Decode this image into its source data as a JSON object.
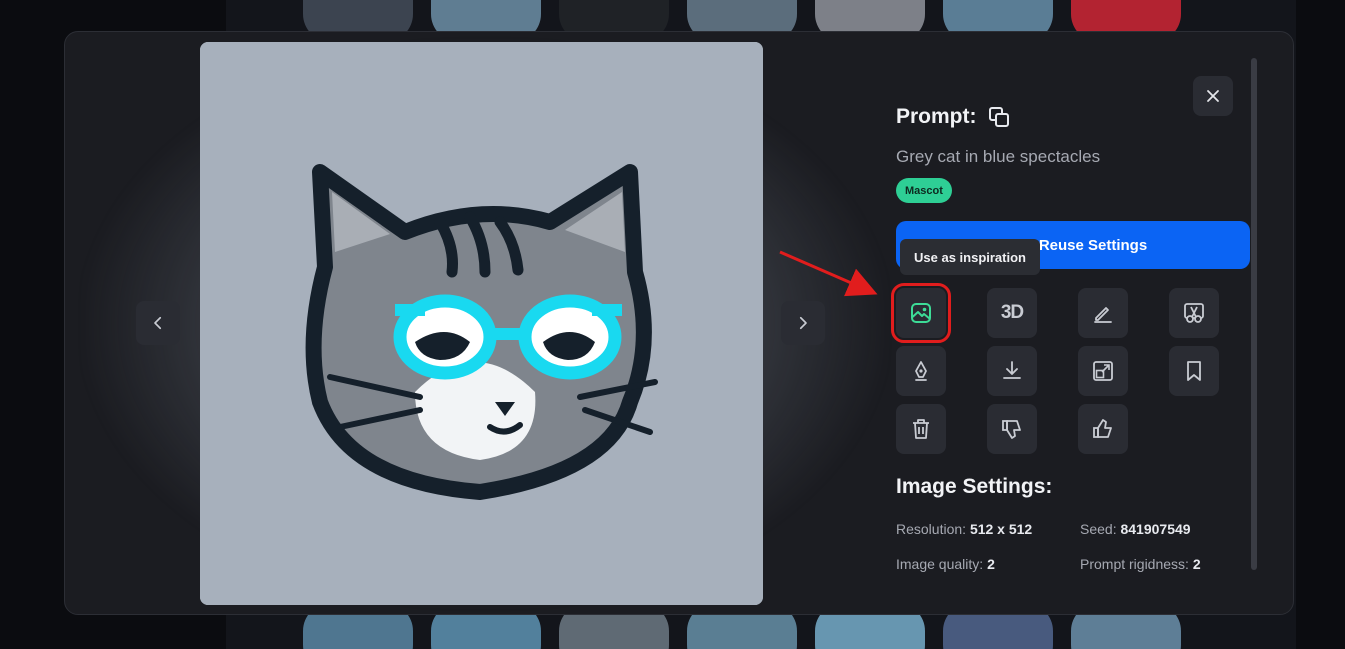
{
  "background_thumbs": {
    "top": [
      "#3c4450",
      "#5f7d92",
      "#1f2226",
      "#5b6d7c",
      "#7d8088",
      "#5a7d95",
      "#b32331"
    ],
    "bottom": [
      "#4f7690",
      "#52809c",
      "#5f6a74",
      "#5a7e93",
      "#6796b0",
      "#485a7e",
      "#5e7e96"
    ]
  },
  "modal": {
    "image": {
      "alt_subject": "cat-mascot",
      "bg_color": "#a7b0bc"
    },
    "nav": {
      "prev_icon": "chevron-left-icon",
      "next_icon": "chevron-right-icon"
    }
  },
  "panel": {
    "close_icon": "close-icon",
    "prompt_label": "Prompt:",
    "copy_icon": "copy-icon",
    "prompt_text": "Grey cat in blue spectacles",
    "tag": "Mascot",
    "reuse_button": "Reuse Settings",
    "tooltip": "Use as inspiration",
    "actions": [
      {
        "name": "use-as-inspiration-button",
        "icon": "image-icon"
      },
      {
        "name": "3d-button",
        "icon": "3d-icon",
        "label": "3D"
      },
      {
        "name": "edit-button",
        "icon": "pencil-icon"
      },
      {
        "name": "remove-background-button",
        "icon": "scissors-icon"
      },
      {
        "name": "vectorize-button",
        "icon": "pen-nib-icon"
      },
      {
        "name": "download-button",
        "icon": "download-icon"
      },
      {
        "name": "upscale-button",
        "icon": "expand-icon"
      },
      {
        "name": "bookmark-button",
        "icon": "bookmark-icon"
      },
      {
        "name": "delete-button",
        "icon": "trash-icon"
      },
      {
        "name": "dislike-button",
        "icon": "thumbs-down-icon"
      },
      {
        "name": "like-button",
        "icon": "thumbs-up-icon"
      }
    ],
    "image_settings": {
      "title": "Image Settings:",
      "resolution_label": "Resolution:",
      "resolution_value": "512 x 512",
      "seed_label": "Seed:",
      "seed_value": "841907549",
      "quality_label": "Image quality:",
      "quality_value": "2",
      "rigidness_label": "Prompt rigidness:",
      "rigidness_value": "2"
    }
  },
  "colors": {
    "accent": "#0b64f4",
    "tag": "#2ecf95",
    "highlight": "#e11d1d",
    "icon": "#c9ccd3",
    "icon_active": "#3ddc97"
  }
}
